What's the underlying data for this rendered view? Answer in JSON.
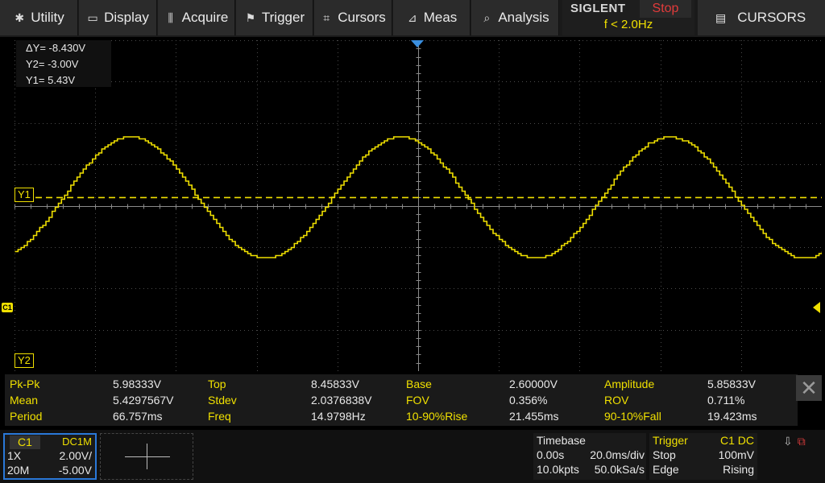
{
  "menu": [
    {
      "label": "Utility",
      "icon": "utility-icon",
      "glyph": "✱"
    },
    {
      "label": "Display",
      "icon": "display-icon",
      "glyph": "▭"
    },
    {
      "label": "Acquire",
      "icon": "acquire-icon",
      "glyph": "⫼"
    },
    {
      "label": "Trigger",
      "icon": "trigger-icon",
      "glyph": "⚑"
    },
    {
      "label": "Cursors",
      "icon": "cursors-icon",
      "glyph": "⌗"
    },
    {
      "label": "Meas",
      "icon": "meas-icon",
      "glyph": "⊿"
    },
    {
      "label": "Analysis",
      "icon": "analysis-icon",
      "glyph": "⌕"
    }
  ],
  "brand": {
    "logo": "SIGLENT",
    "run_state": "Stop",
    "freq": "f < 2.0Hz"
  },
  "menu_title": {
    "label": "CURSORS",
    "icon": "menu-panel-icon"
  },
  "cursor_readout": {
    "delta_y": "ΔY= -8.430V",
    "y2": "Y2= -3.00V",
    "y1": "Y1= 5.43V"
  },
  "markers": {
    "y1": "Y1",
    "y2": "Y2",
    "channel": "C1"
  },
  "waveform": {
    "color": "#f0e000",
    "volts_per_div": 2.0,
    "offset_volts": -5.0,
    "time_per_div_ms": 20.0,
    "center_volts": 5.43,
    "amplitude_volts": 2.93,
    "frequency_hz": 14.98,
    "first_peak_ms": -71.5,
    "y1_volts": 5.43,
    "y2_volts": -3.0
  },
  "measurements": [
    [
      {
        "label": "Pk-Pk",
        "value": "5.98333V"
      },
      {
        "label": "Top",
        "value": "8.45833V"
      },
      {
        "label": "Base",
        "value": "2.60000V"
      },
      {
        "label": "Amplitude",
        "value": "5.85833V"
      }
    ],
    [
      {
        "label": "Mean",
        "value": "5.4297567V"
      },
      {
        "label": "Stdev",
        "value": "2.0376838V"
      },
      {
        "label": "FOV",
        "value": "0.356%"
      },
      {
        "label": "ROV",
        "value": "0.711%"
      }
    ],
    [
      {
        "label": "Period",
        "value": "66.757ms"
      },
      {
        "label": "Freq",
        "value": "14.9798Hz"
      },
      {
        "label": "10-90%Rise",
        "value": "21.455ms"
      },
      {
        "label": "90-10%Fall",
        "value": "19.423ms"
      }
    ]
  ],
  "channel1": {
    "name": "C1",
    "coupling": "DC1M",
    "probe": "1X",
    "scale": "2.00V/",
    "bandwidth": "20M",
    "offset": "-5.00V"
  },
  "timebase": {
    "title": "Timebase",
    "delay": "0.00s",
    "scale": "20.0ms/div",
    "memory": "10.0kpts",
    "sample_rate": "50.0kSa/s"
  },
  "trigger": {
    "title": "Trigger",
    "source": "C1 DC",
    "state": "Stop",
    "level": "100mV",
    "type": "Edge",
    "slope": "Rising"
  },
  "colors": {
    "accent": "#f0e000",
    "stop": "#e23b3b",
    "selection": "#2a78d8",
    "timebase_marker": "#3a8fe0"
  }
}
